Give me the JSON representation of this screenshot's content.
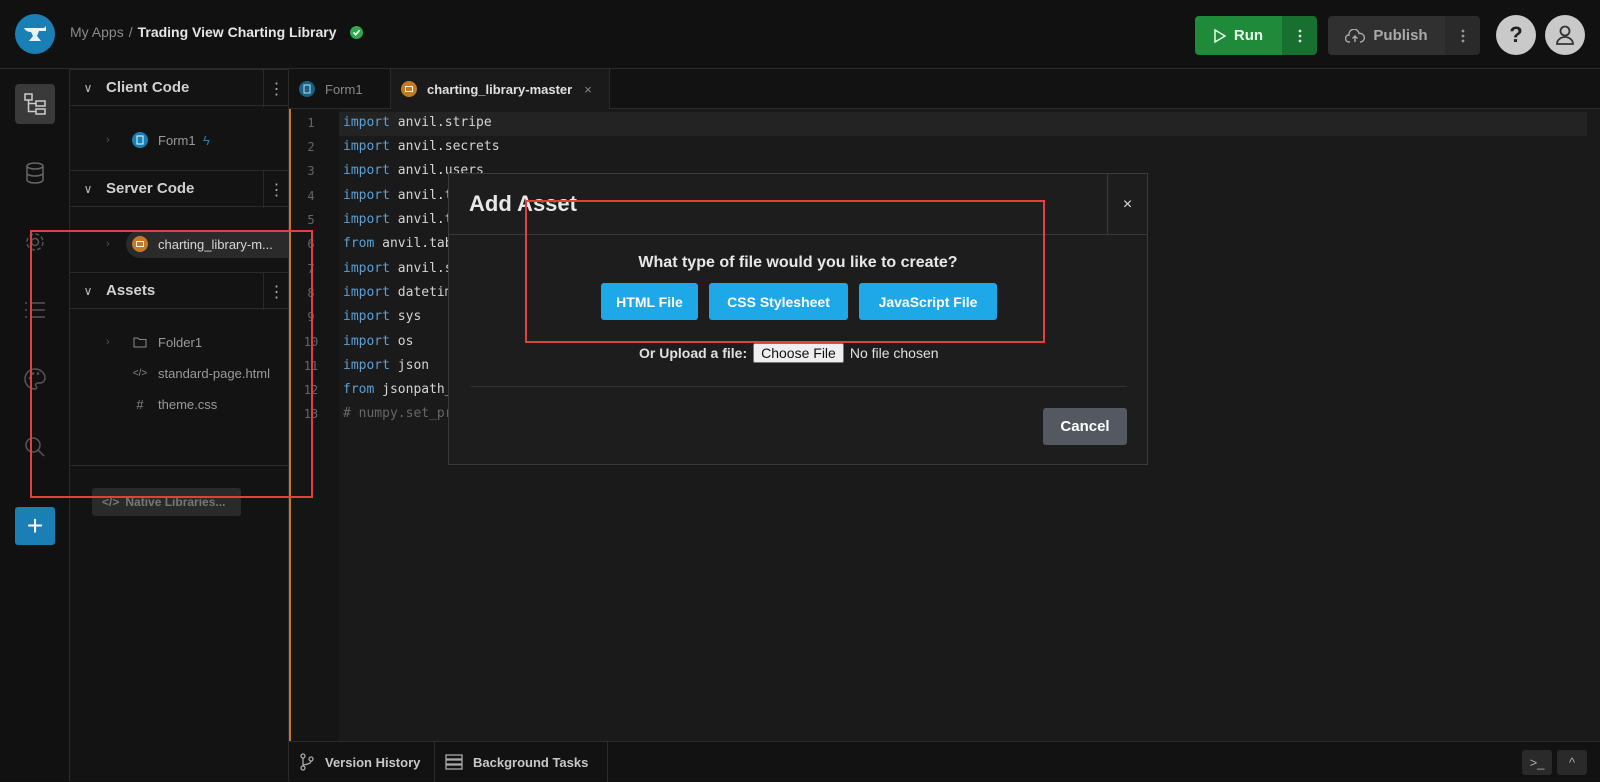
{
  "breadcrumb": {
    "root": "My Apps",
    "sep": "/",
    "app": "Trading View Charting Library"
  },
  "header": {
    "run_label": "Run",
    "publish_label": "Publish",
    "help_glyph": "?"
  },
  "rail": {
    "icons": [
      "app-tree-icon",
      "database-icon",
      "gear-icon",
      "list-icon",
      "palette-icon",
      "search-icon"
    ],
    "add_glyph": "+"
  },
  "explorer": {
    "client_code": {
      "title": "Client Code",
      "items": [
        {
          "label": "Form1"
        }
      ]
    },
    "server_code": {
      "title": "Server Code",
      "items": [
        {
          "label": "charting_library-m..."
        }
      ]
    },
    "assets": {
      "title": "Assets",
      "items": [
        {
          "label": "Folder1"
        },
        {
          "label": "standard-page.html"
        },
        {
          "label": "theme.css"
        }
      ]
    },
    "native_libraries": "Native Libraries..."
  },
  "tabs": [
    {
      "label": "Form1"
    },
    {
      "label": "charting_library-master",
      "close": "×"
    }
  ],
  "editor": {
    "line_numbers": [
      "1",
      "2",
      "3",
      "4",
      "5",
      "6",
      "7",
      "8",
      "9",
      "10",
      "11",
      "12",
      "13"
    ],
    "lines": [
      {
        "kw": "import",
        "rest": " anvil.stripe"
      },
      {
        "kw": "import",
        "rest": " anvil.secrets"
      },
      {
        "kw": "import",
        "rest": " anvil.users"
      },
      {
        "kw": "import",
        "rest": " anvil.t"
      },
      {
        "kw": "import",
        "rest": " anvil.t"
      },
      {
        "kw": "from",
        "rest": " anvil.tab"
      },
      {
        "kw": "import",
        "rest": " anvil.s"
      },
      {
        "kw": "import",
        "rest": " datetim"
      },
      {
        "kw": "import",
        "rest": " sys"
      },
      {
        "kw": "import",
        "rest": " os"
      },
      {
        "kw": "import",
        "rest": " json"
      },
      {
        "kw": "from",
        "rest": " jsonpath_"
      },
      {
        "kw": "",
        "rest": "# numpy.set_pr"
      }
    ]
  },
  "bottombar": {
    "version_history": "Version History",
    "background_tasks": "Background Tasks",
    "terminal_glyph": ">_",
    "expand_glyph": "^"
  },
  "modal": {
    "title": "Add Asset",
    "close": "×",
    "question": "What type of file would you like to create?",
    "buttons": {
      "html": "HTML File",
      "css": "CSS Stylesheet",
      "js": "JavaScript File"
    },
    "upload_label": "Or Upload a file:",
    "choose_file": "Choose File",
    "no_file": "No file chosen",
    "cancel": "Cancel"
  },
  "colors": {
    "accent_blue": "#1fa8e8",
    "run_green": "#1f8a3a",
    "highlight_red": "#e04040",
    "editor_orange": "#c27a2a"
  }
}
